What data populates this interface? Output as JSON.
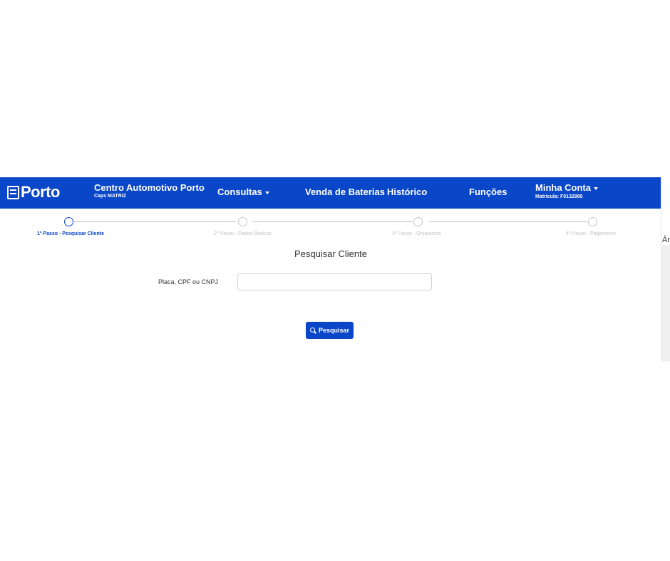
{
  "navbar": {
    "logo_text": "Porto",
    "brand_title": "Centro Automotivo Porto",
    "brand_subtitle": "Caps MATRIZ",
    "items": [
      {
        "label": "Consultas"
      },
      {
        "label": "Venda de Baterias"
      },
      {
        "label": "Histórico"
      },
      {
        "label": "Funções"
      }
    ],
    "account_title": "Minha Conta",
    "account_subtitle": "Matrícula: F0132995"
  },
  "side_panel": {
    "text": "Ár"
  },
  "steps": [
    {
      "label": "1º Passo - Pesquisar Cliente",
      "active": true
    },
    {
      "label": "2º Passo - Dados Básicos",
      "active": false
    },
    {
      "label": "3º Passo - Orçamento",
      "active": false
    },
    {
      "label": "4º Passo - Pagamento",
      "active": false
    }
  ],
  "main": {
    "title": "Pesquisar Cliente",
    "field_label": "Placa, CPF ou CNPJ",
    "field_value": "",
    "search_button_label": "Pesquisar"
  },
  "colors": {
    "accent": "#0a46c8",
    "inactive": "#c6c6c6"
  }
}
